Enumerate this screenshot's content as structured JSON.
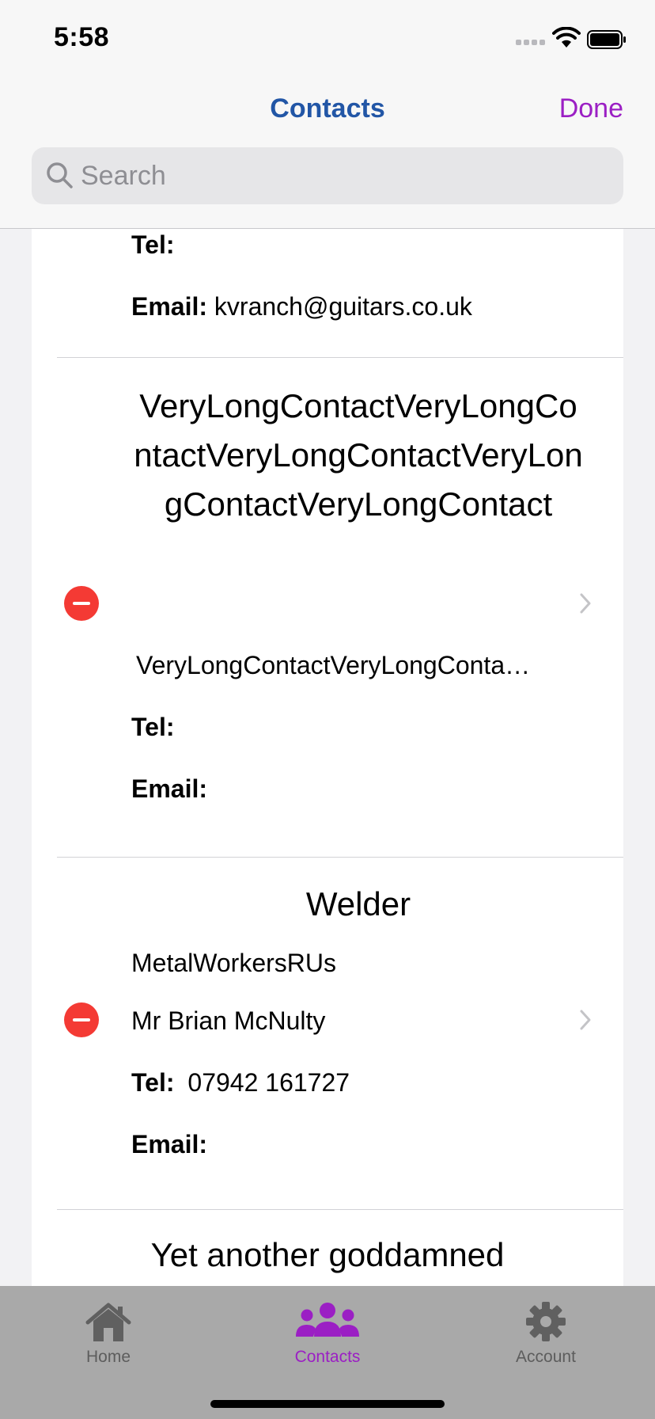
{
  "status_bar": {
    "time": "5:58"
  },
  "nav": {
    "title": "Contacts",
    "done_label": "Done"
  },
  "search": {
    "placeholder": "Search",
    "value": ""
  },
  "labels": {
    "tel": "Tel:",
    "email": "Email:"
  },
  "contacts": [
    {
      "tel": "",
      "email": "kvranch@guitars.co.uk"
    },
    {
      "name": "VeryLongContactVeryLongContactVeryLongContactVeryLongContactVeryLongContact",
      "company": "",
      "person": "VeryLongContactVeryLongConta…",
      "tel": "",
      "email": ""
    },
    {
      "name": "Welder",
      "company": "MetalWorkersRUs",
      "person": "Mr Brian McNulty",
      "tel": "07942 161727",
      "email": ""
    },
    {
      "name": "Yet another goddamned"
    }
  ],
  "tabs": [
    {
      "label": "Home",
      "icon": "house-icon",
      "active": false
    },
    {
      "label": "Contacts",
      "icon": "people-icon",
      "active": true
    },
    {
      "label": "Account",
      "icon": "gear-icon",
      "active": false
    }
  ],
  "colors": {
    "accent": "#9b1fc4",
    "title": "#2256a6",
    "delete": "#f43a34"
  }
}
